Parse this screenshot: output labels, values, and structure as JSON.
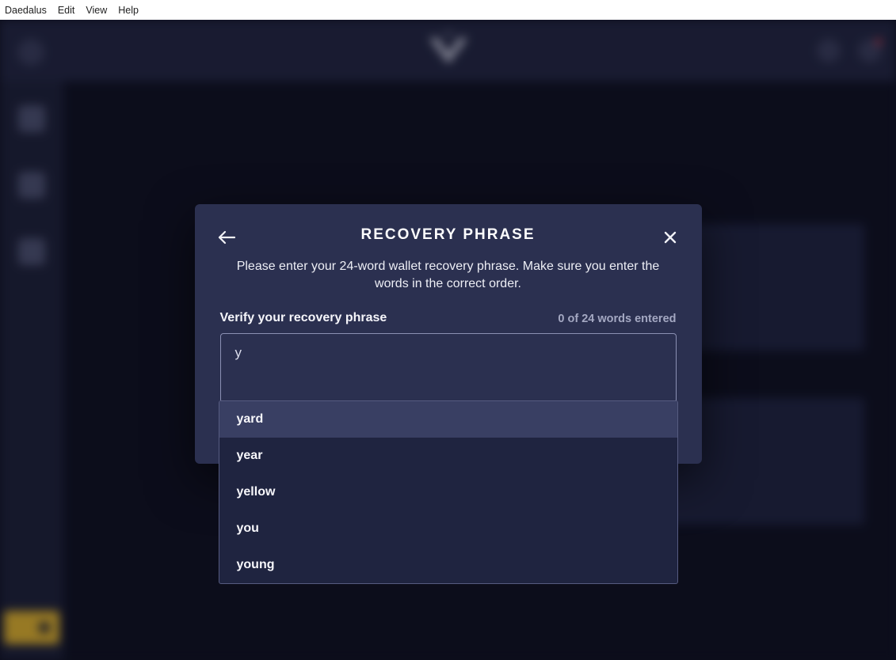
{
  "menubar": {
    "items": [
      "Daedalus",
      "Edit",
      "View",
      "Help"
    ]
  },
  "modal": {
    "title": "RECOVERY PHRASE",
    "description": "Please enter your 24-word wallet recovery phrase. Make sure you enter the words in the correct order.",
    "verify_label": "Verify your recovery phrase",
    "count_label": "0 of 24 words entered",
    "input_value": "y"
  },
  "suggestions": [
    "yard",
    "year",
    "yellow",
    "you",
    "young"
  ]
}
